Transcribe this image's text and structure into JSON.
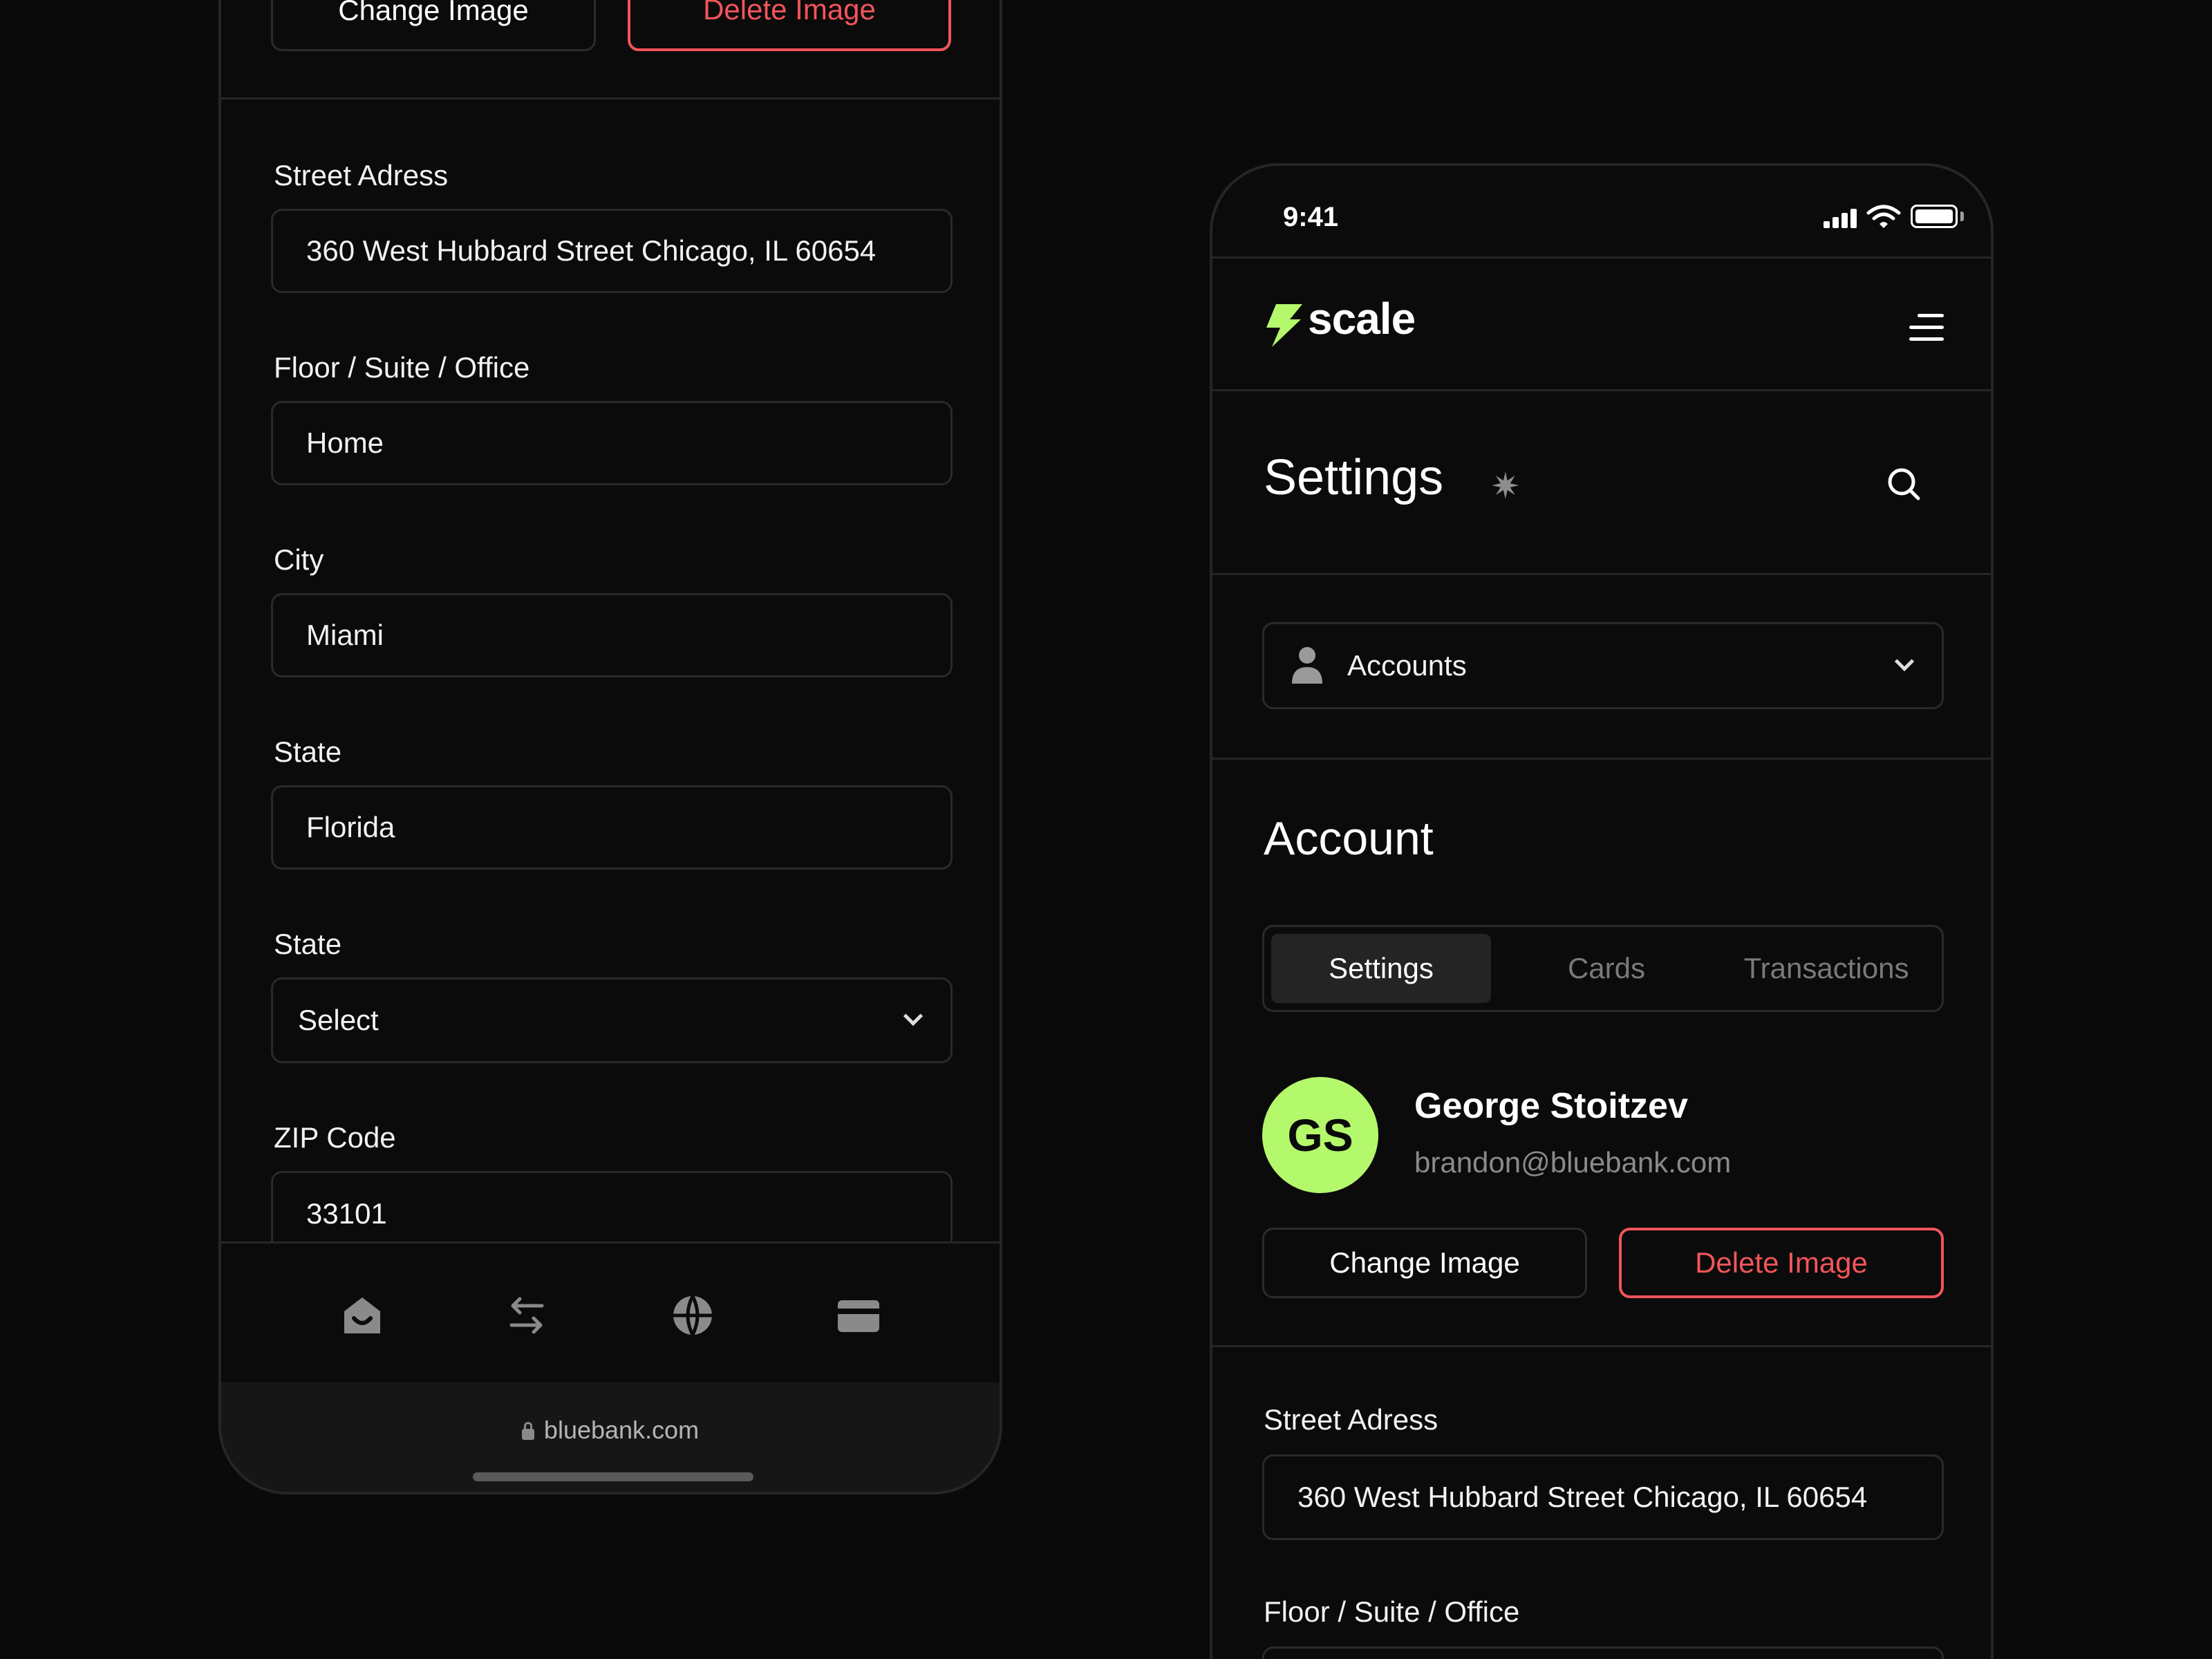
{
  "left_screen": {
    "top_buttons": {
      "change_image": "Change Image",
      "delete_image": "Delete Image"
    },
    "fields": [
      {
        "label": "Street Adress",
        "value": "360 West Hubbard Street Chicago, IL 60654"
      },
      {
        "label": "Floor / Suite / Office",
        "value": "Home"
      },
      {
        "label": "City",
        "value": "Miami"
      },
      {
        "label": "State",
        "value": "Florida"
      },
      {
        "label": "State",
        "value": "Select"
      },
      {
        "label": "ZIP Code",
        "value": "33101"
      }
    ],
    "bottom_nav": [
      "home-icon",
      "transfer-arrows-icon",
      "globe-icon",
      "card-icon"
    ],
    "browser": {
      "url": "bluebank.com"
    }
  },
  "right_screen": {
    "status": {
      "time": "9:41"
    },
    "brand": {
      "name": "scale",
      "accent": "#b4f86b"
    },
    "page_title": "Settings",
    "account_selector": {
      "label": "Accounts"
    },
    "section_title": "Account",
    "tabs": [
      "Settings",
      "Cards",
      "Transactions"
    ],
    "active_tab": "Settings",
    "user": {
      "initials": "GS",
      "name": "George Stoitzev",
      "email": "brandon@bluebank.com"
    },
    "buttons": {
      "change_image": "Change Image",
      "delete_image": "Delete Image"
    },
    "fields": [
      {
        "label": "Street Adress",
        "value": "360 West Hubbard Street Chicago, IL 60654"
      },
      {
        "label": "Floor / Suite / Office",
        "value": ""
      }
    ]
  },
  "colors": {
    "background": "#0a0a0a",
    "danger": "#f2555a",
    "accent": "#b4f86b",
    "border": "#2a2a2a"
  }
}
